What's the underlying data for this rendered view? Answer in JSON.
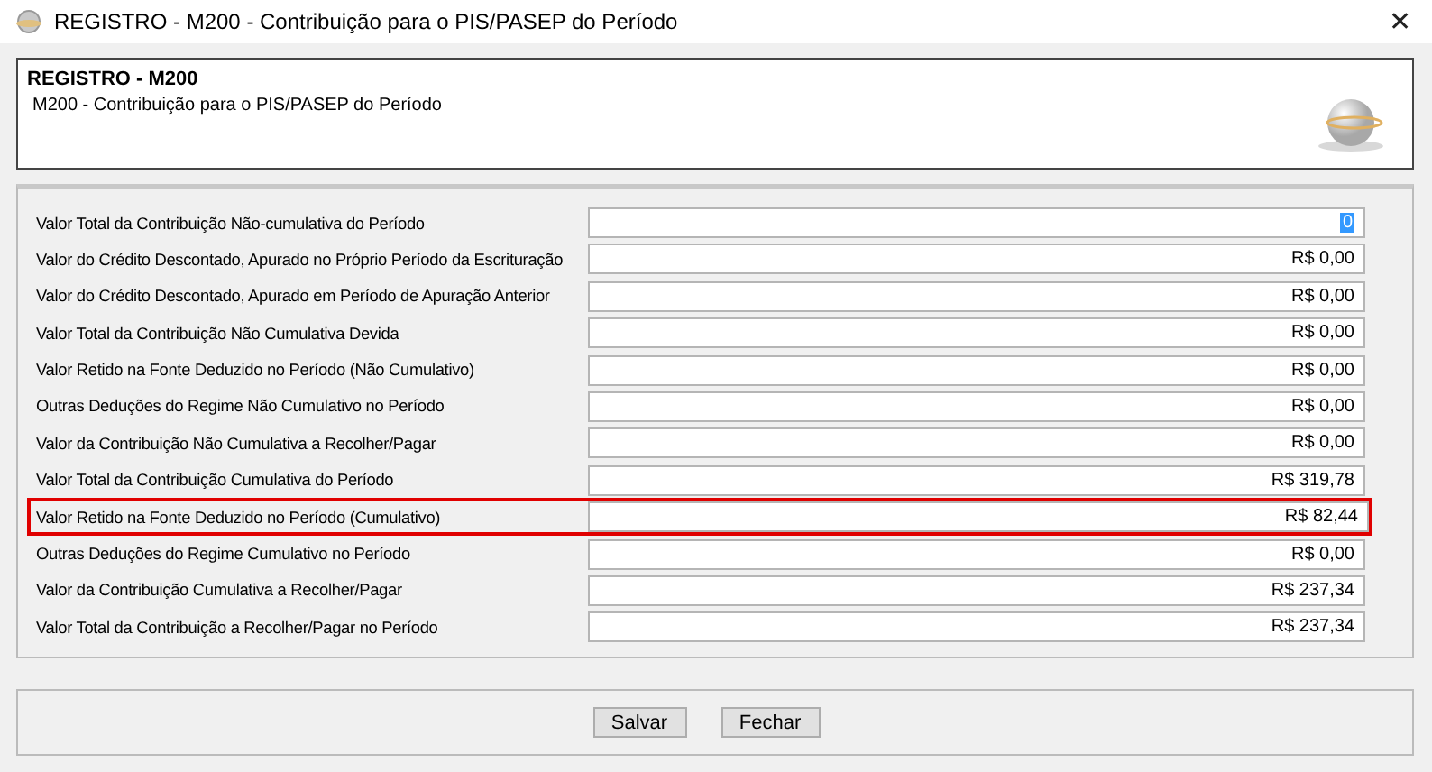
{
  "window": {
    "title": "REGISTRO - M200 - Contribuição para o PIS/PASEP do Período",
    "close": "✕"
  },
  "header": {
    "title": "REGISTRO - M200",
    "subtitle": "M200 - Contribuição para o PIS/PASEP do Período"
  },
  "fields": [
    {
      "label": "Valor Total da Contribuição Não-cumulativa do Período",
      "value": "0",
      "focused": true,
      "highlighted": false
    },
    {
      "label": "Valor do Crédito Descontado, Apurado no Próprio Período da Escrituração",
      "value": "R$ 0,00",
      "focused": false,
      "highlighted": false
    },
    {
      "label": "Valor do Crédito Descontado, Apurado em Período de Apuração Anterior",
      "value": "R$ 0,00",
      "focused": false,
      "highlighted": false
    },
    {
      "label": "Valor Total da Contribuição Não Cumulativa Devida",
      "value": "R$ 0,00",
      "focused": false,
      "highlighted": false
    },
    {
      "label": "Valor Retido na Fonte Deduzido no Período (Não Cumulativo)",
      "value": "R$ 0,00",
      "focused": false,
      "highlighted": false
    },
    {
      "label": "Outras Deduções do Regime Não Cumulativo no Período",
      "value": "R$ 0,00",
      "focused": false,
      "highlighted": false
    },
    {
      "label": "Valor da Contribuição Não Cumulativa a Recolher/Pagar",
      "value": "R$ 0,00",
      "focused": false,
      "highlighted": false
    },
    {
      "label": "Valor Total da Contribuição Cumulativa do Período",
      "value": "R$ 319,78",
      "focused": false,
      "highlighted": false
    },
    {
      "label": "Valor Retido na Fonte Deduzido no Período (Cumulativo)",
      "value": "R$ 82,44",
      "focused": false,
      "highlighted": true
    },
    {
      "label": "Outras Deduções do Regime Cumulativo no Período",
      "value": "R$ 0,00",
      "focused": false,
      "highlighted": false
    },
    {
      "label": "Valor da Contribuição Cumulativa a Recolher/Pagar",
      "value": "R$ 237,34",
      "focused": false,
      "highlighted": false
    },
    {
      "label": "Valor Total da Contribuição a Recolher/Pagar no Período",
      "value": "R$ 237,34",
      "focused": false,
      "highlighted": false
    }
  ],
  "buttons": [
    "Salvar",
    "Fechar"
  ]
}
